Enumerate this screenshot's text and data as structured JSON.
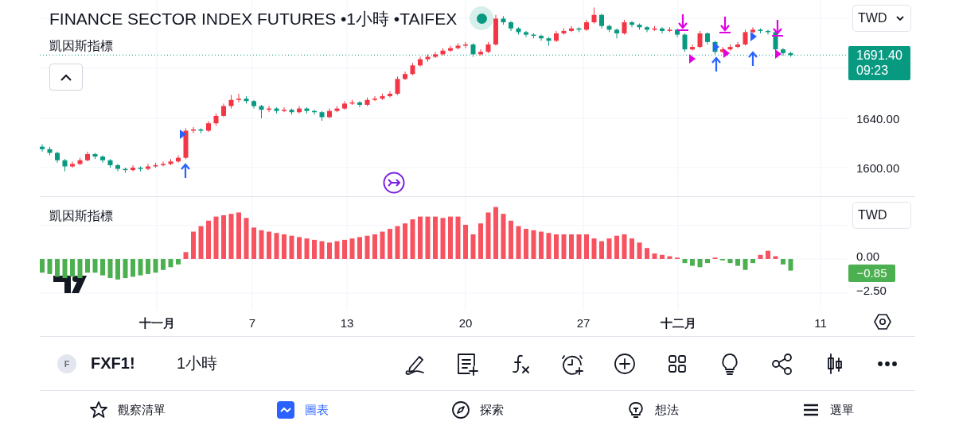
{
  "chart": {
    "title": "FINANCE SECTOR INDEX FUTURES •1小時 •TAIFEX",
    "market_open": true,
    "indicator_label": "凱因斯指標",
    "currency": "TWD",
    "last_price": "1691.40",
    "countdown": "09:23",
    "chart_data": {
      "type": "candlestick",
      "grid": true,
      "ylim": [
        1576.8,
        1736.1
      ],
      "ref_lines": [
        {
          "axis": "y",
          "value": 1691.4
        }
      ],
      "yticks": [
        {
          "value": 1640,
          "label": "1640.00"
        },
        {
          "value": 1600,
          "label": "1600.00"
        }
      ],
      "categories": [
        null,
        null,
        null,
        null,
        null,
        null,
        null,
        null,
        null,
        null,
        null,
        null,
        null,
        null,
        null,
        null,
        null,
        null,
        null,
        null,
        null,
        null,
        null,
        null,
        null,
        null,
        null,
        null,
        null,
        null,
        null,
        null,
        null,
        null,
        null,
        null,
        null,
        null,
        null,
        null,
        null,
        null,
        null,
        null,
        null,
        null,
        null,
        null,
        null,
        null,
        null,
        null,
        null,
        null,
        null,
        null,
        null,
        null,
        null,
        null,
        null,
        null,
        null,
        null,
        null,
        null,
        null,
        null,
        null,
        null,
        null,
        null,
        null,
        null,
        null,
        null,
        null,
        null,
        null,
        null,
        null,
        null,
        null,
        null,
        null,
        null,
        null,
        null,
        null,
        null,
        null,
        null,
        null,
        null,
        null,
        null,
        null,
        null,
        null,
        null
      ],
      "ohlc": [
        [
          1617,
          1619,
          1613,
          1615
        ],
        [
          1615,
          1617,
          1610,
          1612
        ],
        [
          1612,
          1613,
          1604,
          1606
        ],
        [
          1606,
          1607,
          1597,
          1601
        ],
        [
          1601,
          1605,
          1600,
          1603
        ],
        [
          1603,
          1608,
          1602,
          1606
        ],
        [
          1606,
          1613,
          1605,
          1611
        ],
        [
          1611,
          1612,
          1607,
          1609
        ],
        [
          1609,
          1610,
          1604,
          1606
        ],
        [
          1606,
          1607,
          1600,
          1602
        ],
        [
          1602,
          1603,
          1597,
          1599
        ],
        [
          1599,
          1600,
          1596,
          1598
        ],
        [
          1598,
          1602,
          1597,
          1600
        ],
        [
          1600,
          1601,
          1597,
          1599
        ],
        [
          1599,
          1603,
          1598,
          1601
        ],
        [
          1601,
          1604,
          1600,
          1602
        ],
        [
          1602,
          1605,
          1601,
          1603
        ],
        [
          1603,
          1607,
          1602,
          1605
        ],
        [
          1605,
          1610,
          1604,
          1608
        ],
        [
          1608,
          1632,
          1607,
          1630
        ],
        [
          1630,
          1633,
          1628,
          1631
        ],
        [
          1631,
          1632,
          1628,
          1630
        ],
        [
          1630,
          1638,
          1629,
          1636
        ],
        [
          1636,
          1644,
          1634,
          1642
        ],
        [
          1642,
          1652,
          1641,
          1650
        ],
        [
          1650,
          1659,
          1648,
          1655
        ],
        [
          1655,
          1660,
          1653,
          1656
        ],
        [
          1656,
          1658,
          1652,
          1654
        ],
        [
          1654,
          1655,
          1648,
          1650
        ],
        [
          1650,
          1651,
          1640,
          1647
        ],
        [
          1647,
          1650,
          1645,
          1648
        ],
        [
          1648,
          1649,
          1644,
          1646
        ],
        [
          1646,
          1649,
          1645,
          1647
        ],
        [
          1647,
          1648,
          1643,
          1645
        ],
        [
          1645,
          1650,
          1644,
          1648
        ],
        [
          1648,
          1649,
          1644,
          1646
        ],
        [
          1646,
          1647,
          1643,
          1645
        ],
        [
          1645,
          1646,
          1638,
          1641
        ],
        [
          1641,
          1648,
          1640,
          1646
        ],
        [
          1646,
          1650,
          1645,
          1648
        ],
        [
          1648,
          1654,
          1647,
          1652
        ],
        [
          1652,
          1655,
          1651,
          1653
        ],
        [
          1653,
          1654,
          1649,
          1651
        ],
        [
          1651,
          1657,
          1650,
          1655
        ],
        [
          1655,
          1658,
          1654,
          1656
        ],
        [
          1656,
          1660,
          1655,
          1658
        ],
        [
          1658,
          1662,
          1657,
          1660
        ],
        [
          1660,
          1674,
          1659,
          1672
        ],
        [
          1672,
          1678,
          1671,
          1676
        ],
        [
          1676,
          1685,
          1675,
          1683
        ],
        [
          1683,
          1690,
          1682,
          1688
        ],
        [
          1688,
          1692,
          1686,
          1690
        ],
        [
          1690,
          1694,
          1689,
          1692
        ],
        [
          1692,
          1697,
          1691,
          1695
        ],
        [
          1695,
          1699,
          1694,
          1697
        ],
        [
          1697,
          1701,
          1696,
          1699
        ],
        [
          1699,
          1702,
          1697,
          1700
        ],
        [
          1700,
          1701,
          1690,
          1692
        ],
        [
          1692,
          1696,
          1691,
          1694
        ],
        [
          1694,
          1702,
          1693,
          1700
        ],
        [
          1700,
          1724,
          1699,
          1721
        ],
        [
          1721,
          1723,
          1716,
          1718
        ],
        [
          1718,
          1719,
          1711,
          1713
        ],
        [
          1713,
          1714,
          1708,
          1710
        ],
        [
          1710,
          1711,
          1706,
          1708
        ],
        [
          1708,
          1709,
          1705,
          1707
        ],
        [
          1707,
          1708,
          1703,
          1705
        ],
        [
          1705,
          1706,
          1699,
          1703
        ],
        [
          1703,
          1711,
          1702,
          1709
        ],
        [
          1709,
          1713,
          1708,
          1711
        ],
        [
          1711,
          1715,
          1710,
          1713
        ],
        [
          1713,
          1714,
          1710,
          1712
        ],
        [
          1712,
          1720,
          1711,
          1718
        ],
        [
          1718,
          1730,
          1717,
          1724
        ],
        [
          1724,
          1725,
          1713,
          1715
        ],
        [
          1715,
          1716,
          1710,
          1712
        ],
        [
          1712,
          1713,
          1705,
          1709
        ],
        [
          1709,
          1720,
          1708,
          1718
        ],
        [
          1718,
          1719,
          1714,
          1716
        ],
        [
          1716,
          1717,
          1712,
          1714
        ],
        [
          1714,
          1715,
          1710,
          1712
        ],
        [
          1712,
          1715,
          1711,
          1713
        ],
        [
          1713,
          1714,
          1709,
          1711
        ],
        [
          1711,
          1714,
          1710,
          1712
        ],
        [
          1712,
          1713,
          1706,
          1708
        ],
        [
          1708,
          1709,
          1694,
          1696
        ],
        [
          1696,
          1700,
          1695,
          1698
        ],
        [
          1698,
          1711,
          1697,
          1709
        ],
        [
          1709,
          1710,
          1700,
          1702
        ],
        [
          1702,
          1703,
          1692,
          1694
        ],
        [
          1694,
          1698,
          1693,
          1696
        ],
        [
          1696,
          1700,
          1695,
          1698
        ],
        [
          1698,
          1702,
          1697,
          1700
        ],
        [
          1700,
          1712,
          1699,
          1710
        ],
        [
          1710,
          1714,
          1709,
          1712
        ],
        [
          1712,
          1713,
          1709,
          1711
        ],
        [
          1711,
          1712,
          1708,
          1710
        ],
        [
          1710,
          1711,
          1694,
          1696
        ],
        [
          1696,
          1697,
          1691,
          1693
        ],
        [
          1693,
          1694,
          1690,
          1691.4
        ]
      ]
    }
  },
  "indicator": {
    "label": "凱因斯指標",
    "currency": "TWD",
    "last_value": "−0.85",
    "chart_data": {
      "type": "bar",
      "grid": true,
      "ylim": [
        -3.72,
        4.53
      ],
      "categories": [
        null,
        null,
        null,
        null,
        null,
        null,
        null,
        null,
        null,
        null,
        null,
        null,
        null,
        null,
        null,
        null,
        null,
        null,
        null,
        null,
        null,
        null,
        null,
        null,
        null,
        null,
        null,
        null,
        null,
        null,
        null,
        null,
        null,
        null,
        null,
        null,
        null,
        null,
        null,
        null,
        null,
        null,
        null,
        null,
        null,
        null,
        null,
        null,
        null,
        null,
        null,
        null,
        null,
        null,
        null,
        null,
        null,
        null,
        null,
        null,
        null,
        null,
        null,
        null,
        null,
        null,
        null,
        null,
        null,
        null,
        null,
        null,
        null,
        null,
        null,
        null,
        null,
        null,
        null,
        null,
        null,
        null,
        null,
        null,
        null,
        null,
        null,
        null,
        null,
        null,
        null,
        null,
        null,
        null,
        null,
        null,
        null,
        null,
        null,
        null
      ],
      "yticks": [
        {
          "value": 0,
          "label": "0.00"
        },
        {
          "value": -2.5,
          "label": "−2.50"
        }
      ],
      "values": [
        -1.0,
        -1.1,
        -1.3,
        -1.4,
        -1.3,
        -1.4,
        -1.0,
        -1.0,
        -1.2,
        -1.4,
        -1.5,
        -1.4,
        -1.3,
        -1.2,
        -1.1,
        -1.0,
        -0.8,
        -0.6,
        -0.4,
        0.5,
        2.0,
        2.4,
        2.8,
        3.1,
        3.2,
        3.3,
        3.4,
        3.0,
        2.3,
        2.1,
        2.0,
        1.9,
        1.8,
        1.7,
        1.6,
        1.5,
        1.4,
        1.3,
        1.2,
        1.3,
        1.4,
        1.5,
        1.6,
        1.7,
        1.8,
        2.0,
        2.2,
        2.4,
        2.6,
        2.9,
        3.1,
        3.1,
        3.1,
        3.0,
        3.1,
        3.1,
        2.5,
        1.8,
        2.6,
        3.4,
        3.8,
        3.3,
        2.8,
        2.4,
        2.2,
        2.1,
        2.0,
        1.9,
        1.8,
        1.8,
        1.8,
        1.8,
        1.8,
        1.5,
        1.3,
        1.5,
        1.7,
        1.8,
        1.5,
        1.2,
        0.8,
        0.4,
        0.3,
        0.2,
        0.1,
        -0.3,
        -0.5,
        -0.6,
        -0.3,
        0.1,
        -0.1,
        -0.3,
        -0.5,
        -0.8,
        -0.3,
        0.3,
        0.6,
        0.2,
        -0.4,
        -0.85
      ]
    }
  },
  "time_axis": [
    {
      "label": "十一月",
      "kind": "month"
    },
    {
      "label": "7",
      "kind": "day"
    },
    {
      "label": "13",
      "kind": "day"
    },
    {
      "label": "20",
      "kind": "day"
    },
    {
      "label": "27",
      "kind": "day"
    },
    {
      "label": "十二月",
      "kind": "month"
    },
    {
      "label": "11",
      "kind": "day"
    }
  ],
  "symbol_bar": {
    "avatar": "F",
    "symbol": "FXF1!",
    "interval": "1小時"
  },
  "nav": [
    {
      "label": "觀察清單",
      "selected": false
    },
    {
      "label": "圖表",
      "selected": true
    },
    {
      "label": "探索",
      "selected": false
    },
    {
      "label": "想法",
      "selected": false
    },
    {
      "label": "選單",
      "selected": false
    }
  ]
}
